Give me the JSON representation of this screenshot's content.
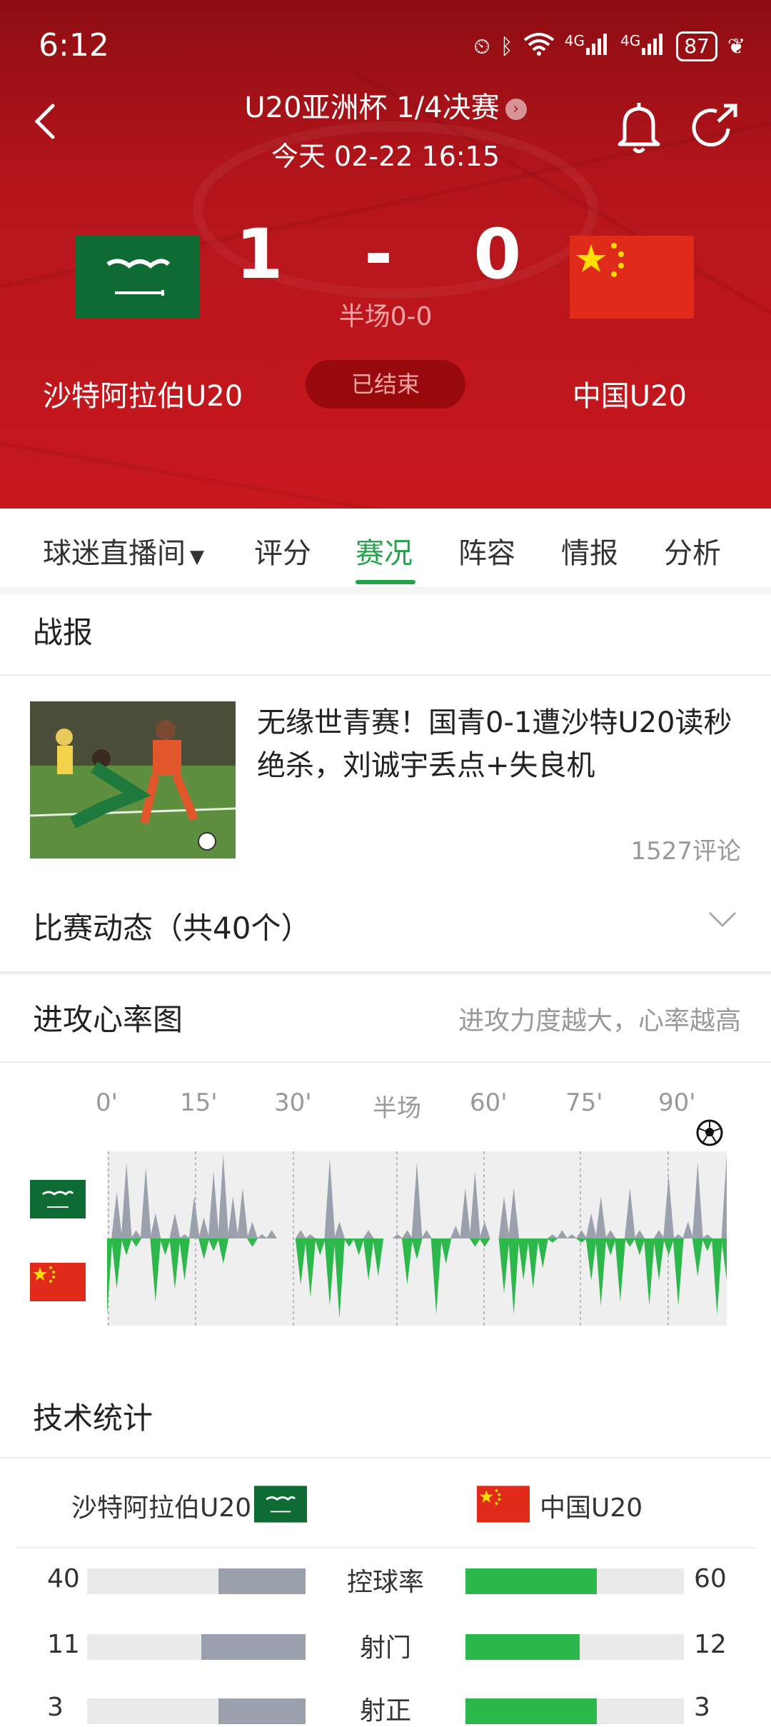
{
  "status_bar": {
    "time": "6:12",
    "battery": "87",
    "network_left": "4G",
    "network_right": "4G"
  },
  "header": {
    "competition": "U20亚洲杯 1/4决赛",
    "date": "今天 02-22 16:15",
    "score_home": "1",
    "score_sep": "-",
    "score_away": "0",
    "half_score": "半场0-0",
    "match_status": "已结束",
    "home_team": "沙特阿拉伯U20",
    "away_team": "中国U20"
  },
  "tabs": [
    {
      "label": "球迷直播间"
    },
    {
      "label": "评分"
    },
    {
      "label": "赛况",
      "active": true
    },
    {
      "label": "阵容"
    },
    {
      "label": "情报"
    },
    {
      "label": "分析"
    }
  ],
  "report": {
    "title": "战报",
    "headline": "无缘世青赛！国青0-1遭沙特U20读秒绝杀，刘诚宇丢点+失良机",
    "comments": "1527评论"
  },
  "events": {
    "title": "比赛动态（共40个）"
  },
  "heart_chart": {
    "title": "进攻心率图",
    "subtitle": "进攻力度越大，心率越高",
    "time_labels": [
      "0'",
      "15'",
      "30'",
      "半场",
      "60'",
      "75'",
      "90'"
    ],
    "home_color": "#9aa1ac",
    "away_color": "#2db84b",
    "home_values": [
      0,
      0.55,
      0.9,
      0.1,
      0.85,
      0.3,
      0,
      0.3,
      0.05,
      0.5,
      0.25,
      0.8,
      1,
      0.5,
      0.6,
      0.2,
      0.05,
      0.1,
      0,
      0,
      0.1,
      0.05,
      0,
      0.95,
      0.2,
      0,
      0,
      0.1,
      0,
      0,
      0.05,
      0.1,
      0.9,
      0.1,
      0,
      0,
      0.15,
      0.6,
      0.8,
      0.2,
      0,
      0.5,
      0.6,
      0,
      0,
      0,
      0.05,
      0.1,
      0.05,
      0.1,
      0.3,
      0.5,
      0.1,
      0,
      0.6,
      0.1,
      0,
      0.1,
      0.75,
      0.05,
      0.2,
      0.9,
      0.05,
      0,
      1
    ],
    "away_values": [
      0.9,
      0.6,
      0.2,
      0.1,
      0,
      0.75,
      0.2,
      0.6,
      0.5,
      0,
      0.25,
      0.15,
      0.3,
      0,
      0,
      0.1,
      0,
      0,
      0,
      0,
      0.55,
      0.7,
      0.2,
      0.8,
      0.95,
      0.1,
      0.2,
      0.5,
      0.45,
      0,
      0,
      0.55,
      0.25,
      0,
      0.9,
      0.3,
      0,
      0,
      0.1,
      0.1,
      0,
      0.65,
      0.9,
      0.5,
      0.6,
      0.35,
      0.05,
      0,
      0,
      0.05,
      0.5,
      0.8,
      0.2,
      0.75,
      0.1,
      0.2,
      0.8,
      0.5,
      0.2,
      0.8,
      0,
      0.45,
      0.15,
      0.9,
      0.5
    ],
    "goal_icon": "soccer-ball-icon"
  },
  "stats": {
    "title": "技术统计",
    "home_team": "沙特阿拉伯U20",
    "away_team": "中国U20",
    "rows": [
      {
        "label": "控球率",
        "home": "40",
        "away": "60",
        "home_frac": 0.4,
        "away_frac": 0.6
      },
      {
        "label": "射门",
        "home": "11",
        "away": "12",
        "home_frac": 0.478,
        "away_frac": 0.522
      },
      {
        "label": "射正",
        "home": "3",
        "away": "3",
        "home_frac": 0.4,
        "away_frac": 0.6
      }
    ]
  }
}
